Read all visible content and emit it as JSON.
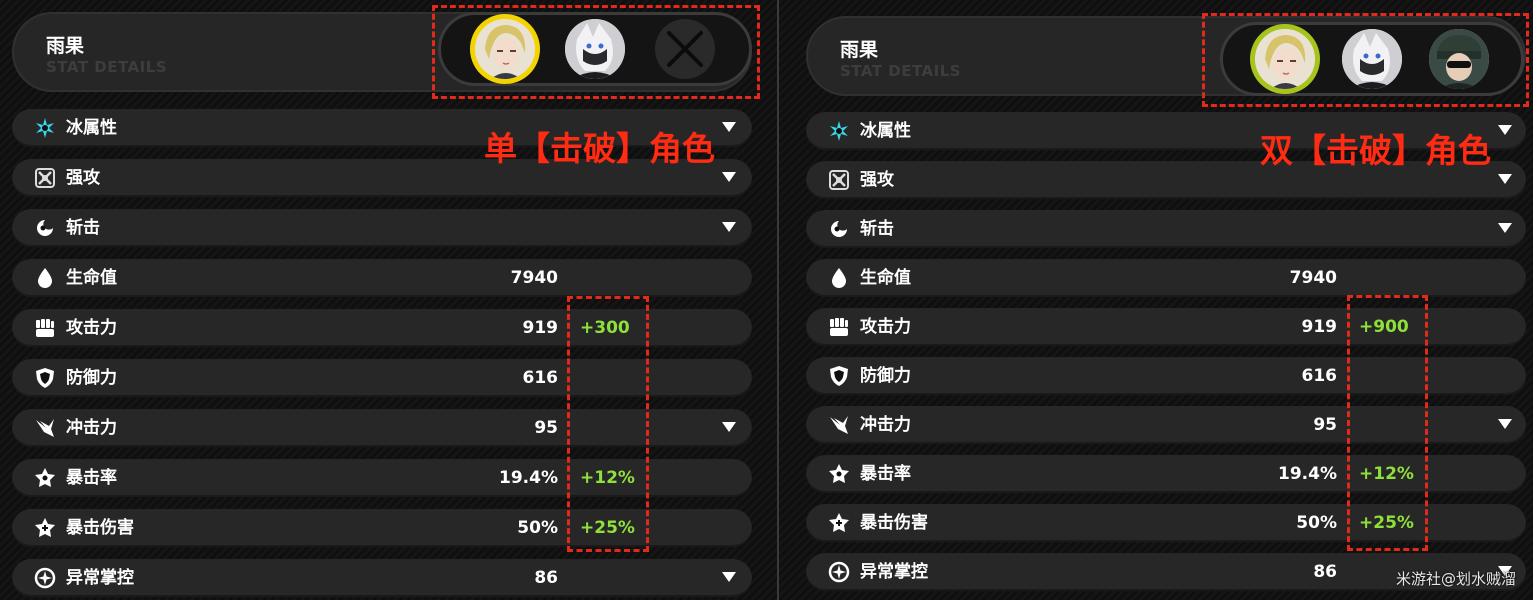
{
  "left": {
    "character_name": "雨果",
    "subtitle": "STAT DETAILS",
    "annotation": "单【击破】角色",
    "rows": [
      {
        "label": "冰属性",
        "value": "",
        "bonus": "",
        "icon": "ice-attribute-icon",
        "expandable": true
      },
      {
        "label": "强攻",
        "value": "",
        "bonus": "",
        "icon": "attack-specialty-icon",
        "expandable": true
      },
      {
        "label": "斩击",
        "value": "",
        "bonus": "",
        "icon": "slash-icon",
        "expandable": true
      },
      {
        "label": "生命值",
        "value": "7940",
        "bonus": "",
        "icon": "hp-drop-icon",
        "expandable": false
      },
      {
        "label": "攻击力",
        "value": "919",
        "bonus": "+300",
        "icon": "attack-fist-icon",
        "expandable": false
      },
      {
        "label": "防御力",
        "value": "616",
        "bonus": "",
        "icon": "defense-shield-icon",
        "expandable": false
      },
      {
        "label": "冲击力",
        "value": "95",
        "bonus": "",
        "icon": "impact-icon",
        "expandable": true
      },
      {
        "label": "暴击率",
        "value": "19.4%",
        "bonus": "+12%",
        "icon": "crit-rate-icon",
        "expandable": false
      },
      {
        "label": "暴击伤害",
        "value": "50%",
        "bonus": "+25%",
        "icon": "crit-damage-icon",
        "expandable": false
      },
      {
        "label": "异常掌控",
        "value": "86",
        "bonus": "",
        "icon": "anomaly-mastery-icon",
        "expandable": true
      }
    ]
  },
  "right": {
    "character_name": "雨果",
    "subtitle": "STAT DETAILS",
    "annotation": "双【击破】角色",
    "rows": [
      {
        "label": "冰属性",
        "value": "",
        "bonus": "",
        "icon": "ice-attribute-icon",
        "expandable": true
      },
      {
        "label": "强攻",
        "value": "",
        "bonus": "",
        "icon": "attack-specialty-icon",
        "expandable": true
      },
      {
        "label": "斩击",
        "value": "",
        "bonus": "",
        "icon": "slash-icon",
        "expandable": true
      },
      {
        "label": "生命值",
        "value": "7940",
        "bonus": "",
        "icon": "hp-drop-icon",
        "expandable": false
      },
      {
        "label": "攻击力",
        "value": "919",
        "bonus": "+900",
        "icon": "attack-fist-icon",
        "expandable": false
      },
      {
        "label": "防御力",
        "value": "616",
        "bonus": "",
        "icon": "defense-shield-icon",
        "expandable": false
      },
      {
        "label": "冲击力",
        "value": "95",
        "bonus": "",
        "icon": "impact-icon",
        "expandable": true
      },
      {
        "label": "暴击率",
        "value": "19.4%",
        "bonus": "+12%",
        "icon": "crit-rate-icon",
        "expandable": false
      },
      {
        "label": "暴击伤害",
        "value": "50%",
        "bonus": "+25%",
        "icon": "crit-damage-icon",
        "expandable": false
      },
      {
        "label": "异常掌控",
        "value": "86",
        "bonus": "",
        "icon": "anomaly-mastery-icon",
        "expandable": true
      }
    ]
  },
  "watermark": "米游社@划水贼溜",
  "colors": {
    "annotation_red": "#ff2b13",
    "bonus_green": "#8fe03a",
    "slot_ring_yellow": "#f2d500",
    "slot_ring_lime": "#a7c41c",
    "row_bg": "#272727"
  }
}
